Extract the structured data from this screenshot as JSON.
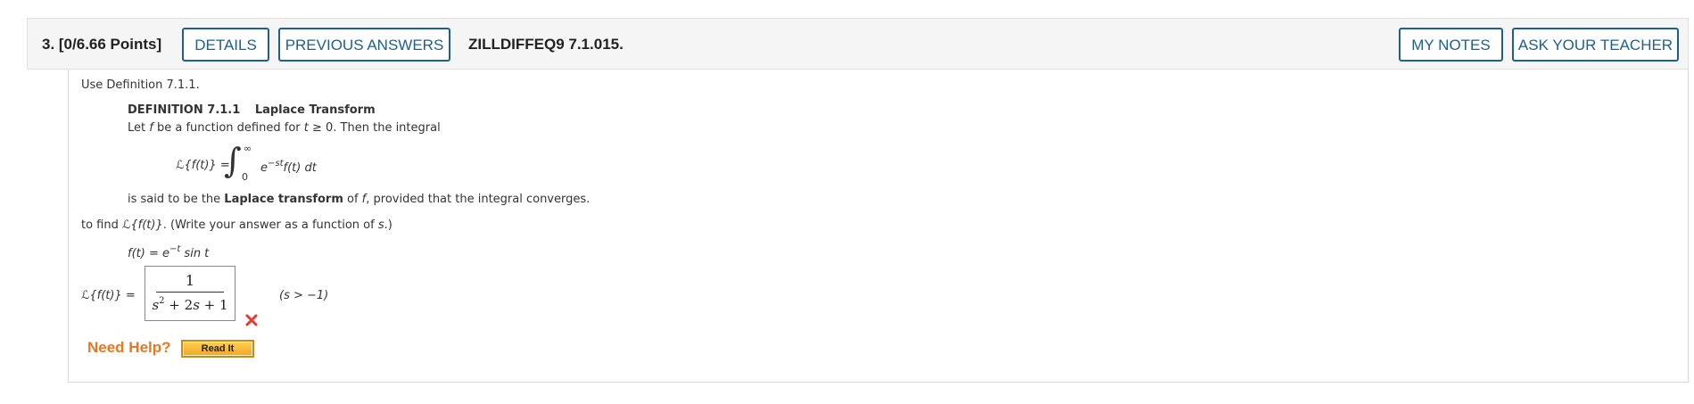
{
  "header": {
    "question_points": "3.  [0/6.66 Points]",
    "details_label": "DETAILS",
    "previous_answers_label": "PREVIOUS ANSWERS",
    "question_code": "ZILLDIFFEQ9 7.1.015.",
    "my_notes_label": "MY NOTES",
    "ask_teacher_label": "ASK YOUR TEACHER"
  },
  "body": {
    "intro": "Use Definition 7.1.1.",
    "definition_number": "DEFINITION 7.1.1",
    "definition_title": "Laplace Transform",
    "def_text_1a": "Let ",
    "def_text_1b": "f",
    "def_text_1c": " be a function defined for ",
    "def_text_1d": "t",
    "def_text_1e": " ≥ 0. Then the integral",
    "formula_lhs": "ℒ{f(t)} =",
    "formula_upper": "∞",
    "formula_lower": "0",
    "formula_integrand_base": "e",
    "formula_integrand_exp": "−st",
    "formula_integrand_rest": "f(t) dt",
    "def_text_2a": "is said to be the ",
    "def_text_2b": "Laplace transform",
    "def_text_2c": " of ",
    "def_text_2d": "f",
    "def_text_2e": ", provided that the integral converges.",
    "task_a": "to find ",
    "task_b": "ℒ{f(t)}",
    "task_c": ". (Write your answer as a function of ",
    "task_d": "s",
    "task_e": ".)",
    "given_lhs": "f(t) = e",
    "given_exp": "−t",
    "given_rhs": " sin t"
  },
  "answer": {
    "label": "ℒ{f(t)} =",
    "numerator": "1",
    "den_s1": "s",
    "den_exp": "2",
    "den_mid": " + 2",
    "den_s2": "s",
    "den_end": " + 1",
    "condition": "(s > −1)",
    "status_icon": "red-x-icon",
    "status_color": "#e53935"
  },
  "help": {
    "need_help_label": "Need Help?",
    "read_it_label": "Read It",
    "need_help_color": "#e87722"
  }
}
